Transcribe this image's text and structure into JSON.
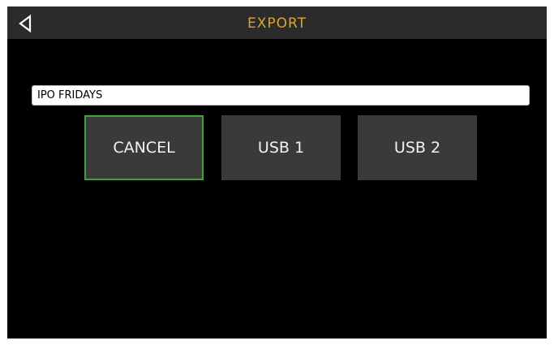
{
  "header": {
    "title": "EXPORT",
    "title_color": "#d9a630",
    "back_icon": "back-triangle-icon"
  },
  "export": {
    "name_value": "IPO FRIDAYS"
  },
  "buttons": {
    "cancel_label": "CANCEL",
    "usb1_label": "USB 1",
    "usb2_label": "USB 2",
    "focus_color": "#3fa33a"
  }
}
